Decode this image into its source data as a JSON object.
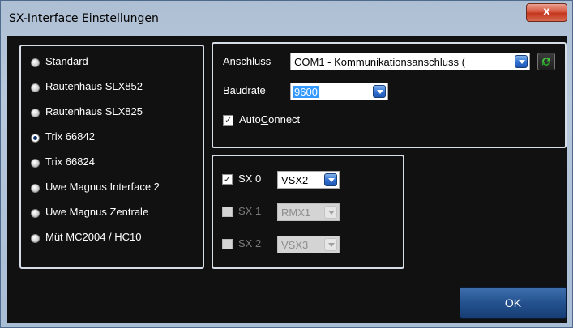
{
  "window": {
    "title": "SX-Interface Einstellungen",
    "close_label": "x"
  },
  "interfaces": {
    "items": [
      {
        "label": "Standard",
        "selected": false
      },
      {
        "label": "Rautenhaus SLX852",
        "selected": false
      },
      {
        "label": "Rautenhaus SLX825",
        "selected": false
      },
      {
        "label": "Trix 66842",
        "selected": true
      },
      {
        "label": "Trix 66824",
        "selected": false
      },
      {
        "label": "Uwe Magnus Interface 2",
        "selected": false
      },
      {
        "label": "Uwe Magnus Zentrale",
        "selected": false
      },
      {
        "label": "Müt MC2004 / HC10",
        "selected": false
      }
    ]
  },
  "connection": {
    "port_label": "Anschluss",
    "port_value": "COM1 - Kommunikationsanschluss (",
    "baud_label": "Baudrate",
    "baud_value": "9600",
    "autoconnect_pre": "Auto",
    "autoconnect_u": "C",
    "autoconnect_post": "onnect",
    "autoconnect_checked": true,
    "refresh_icon": "refresh-icon"
  },
  "sx": {
    "rows": [
      {
        "label": "SX 0",
        "checked": true,
        "enabled": true,
        "value": "VSX2"
      },
      {
        "label": "SX 1",
        "checked": false,
        "enabled": false,
        "value": "RMX1"
      },
      {
        "label": "SX 2",
        "checked": false,
        "enabled": false,
        "value": "VSX3"
      }
    ]
  },
  "buttons": {
    "ok_label": "OK"
  }
}
